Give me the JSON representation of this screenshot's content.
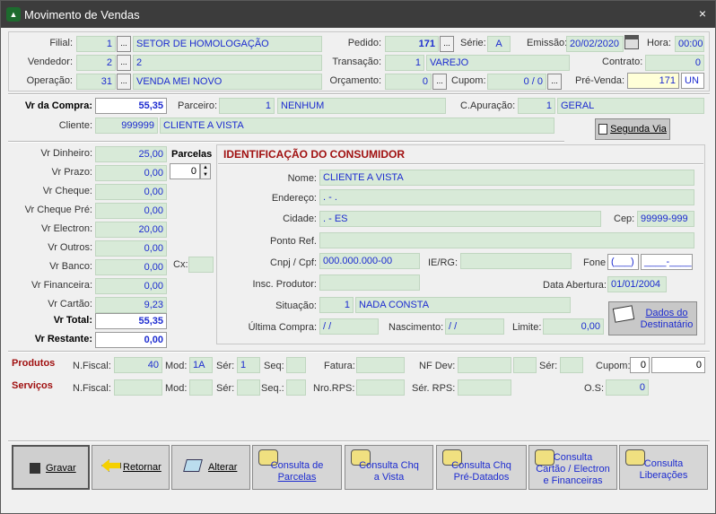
{
  "window": {
    "title": "Movimento de Vendas",
    "close": "×",
    "app_icon": "chart-icon"
  },
  "header": {
    "filial_label": "Filial:",
    "filial_code": "1",
    "filial_name": "SETOR DE HOMOLOGAÇÃO",
    "vendedor_label": "Vendedor:",
    "vendedor_code": "2",
    "vendedor_name": "2",
    "operacao_label": "Operação:",
    "operacao_code": "31",
    "operacao_name": "VENDA MEI NOVO",
    "pedido_label": "Pedido:",
    "pedido_value": "171",
    "serie_label": "Série:",
    "serie_value": "A",
    "emissao_label": "Emissão:",
    "emissao_value": "20/02/2020",
    "hora_label": "Hora:",
    "hora_value": "00:00",
    "transacao_label": "Transação:",
    "transacao_code": "1",
    "transacao_name": "VAREJO",
    "contrato_label": "Contrato:",
    "contrato_value": "0",
    "orcamento_label": "Orçamento:",
    "orcamento_value": "0",
    "cupom_label": "Cupom:",
    "cupom_value": "0 / 0",
    "prevenda_label": "Pré-Venda:",
    "prevenda_value": "171",
    "prevenda_unit": "UN",
    "ellipsis": "..."
  },
  "compra": {
    "vr_compra_label": "Vr da Compra:",
    "vr_compra_value": "55,35",
    "parceiro_label": "Parceiro:",
    "parceiro_code": "1",
    "parceiro_name": "NENHUM",
    "capuracao_label": "C.Apuração:",
    "capuracao_code": "1",
    "capuracao_name": "GERAL",
    "cliente_label": "Cliente:",
    "cliente_code": "999999",
    "cliente_name": "CLIENTE A VISTA",
    "segunda_via_label": "Segunda Via"
  },
  "pagamento": {
    "rows": [
      {
        "label": "Vr Dinheiro:",
        "value": "25,00"
      },
      {
        "label": "Vr Prazo:",
        "value": "0,00"
      },
      {
        "label": "Vr Cheque:",
        "value": "0,00"
      },
      {
        "label": "Vr Cheque Pré:",
        "value": "0,00"
      },
      {
        "label": "Vr Electron:",
        "value": "20,00"
      },
      {
        "label": "Vr Outros:",
        "value": "0,00"
      },
      {
        "label": "Vr Banco:",
        "value": "0,00"
      },
      {
        "label": "Vr Financeira:",
        "value": "0,00"
      },
      {
        "label": "Vr Cartão:",
        "value": "9,23"
      }
    ],
    "total_label": "Vr Total:",
    "total_value": "55,35",
    "restante_label": "Vr Restante:",
    "restante_value": "0,00",
    "parcelas_label": "Parcelas",
    "parcelas_value": "0",
    "cx_label": "Cx:",
    "cx_value": ""
  },
  "consumidor": {
    "title": "IDENTIFICAÇÃO DO CONSUMIDOR",
    "nome_label": "Nome:",
    "nome_value": "CLIENTE A VISTA",
    "endereco_label": "Endereço:",
    "endereco_value": ". - .",
    "cidade_label": "Cidade:",
    "cidade_value": ". - ES",
    "cep_label": "Cep:",
    "cep_value": "99999-999",
    "ponto_label": "Ponto Ref.",
    "ponto_value": "",
    "cnpj_label": "Cnpj / Cpf:",
    "cnpj_value": "000.000.000-00",
    "ierg_label": "IE/RG:",
    "ierg_value": "",
    "fone_label": "Fone",
    "fone_ddd": "(___)",
    "fone_num": "____-____",
    "insc_label": "Insc. Produtor:",
    "insc_value": "",
    "abertura_label": "Data Abertura:",
    "abertura_value": "01/01/2004",
    "situacao_label": "Situação:",
    "situacao_code": "1",
    "situacao_name": "NADA CONSTA",
    "ultima_label": "Última Compra:",
    "ultima_value": "/  /",
    "nascimento_label": "Nascimento:",
    "nascimento_value": "/  /",
    "limite_label": "Limite:",
    "limite_value": "0,00",
    "dados_label_1": "Dados do",
    "dados_label_2": "Destinatário"
  },
  "produtos": {
    "label": "Produtos",
    "nfiscal_label": "N.Fiscal:",
    "nfiscal_value": "40",
    "mod_label": "Mod:",
    "mod_value": "1A",
    "ser_label": "Sér:",
    "ser_value": "1",
    "seq_label": "Seq:",
    "seq_value": "",
    "fatura_label": "Fatura:",
    "fatura_value": "",
    "nfdev_label": "NF Dev:",
    "nfdev_value": "",
    "ser2_label": "Sér:",
    "ser2_value": "",
    "cupom_label": "Cupom:",
    "cupom_a": "0",
    "cupom_b": "0"
  },
  "servicos": {
    "label": "Serviços",
    "nfiscal_label": "N.Fiscal:",
    "mod_label": "Mod:",
    "ser_label": "Sér:",
    "seq_label": "Seq.:",
    "rps_label": "Nro.RPS:",
    "serrps_label": "Sér. RPS:",
    "os_label": "O.S:",
    "os_value": "0"
  },
  "buttons": {
    "gravar": "Gravar",
    "retornar": "Retornar",
    "alterar": "Alterar",
    "parcelas_1": "Consulta de",
    "parcelas_2": "Parcelas",
    "chq_vista_1": "Consulta Chq",
    "chq_vista_2": "a Vista",
    "chq_pre_1": "Consulta Chq",
    "chq_pre_2": "Pré-Datados",
    "cartao_1": "Consulta",
    "cartao_2": "Cartão / Electron",
    "cartao_3": "e Financeiras",
    "lib_1": "Consulta",
    "lib_2": "Liberações"
  }
}
